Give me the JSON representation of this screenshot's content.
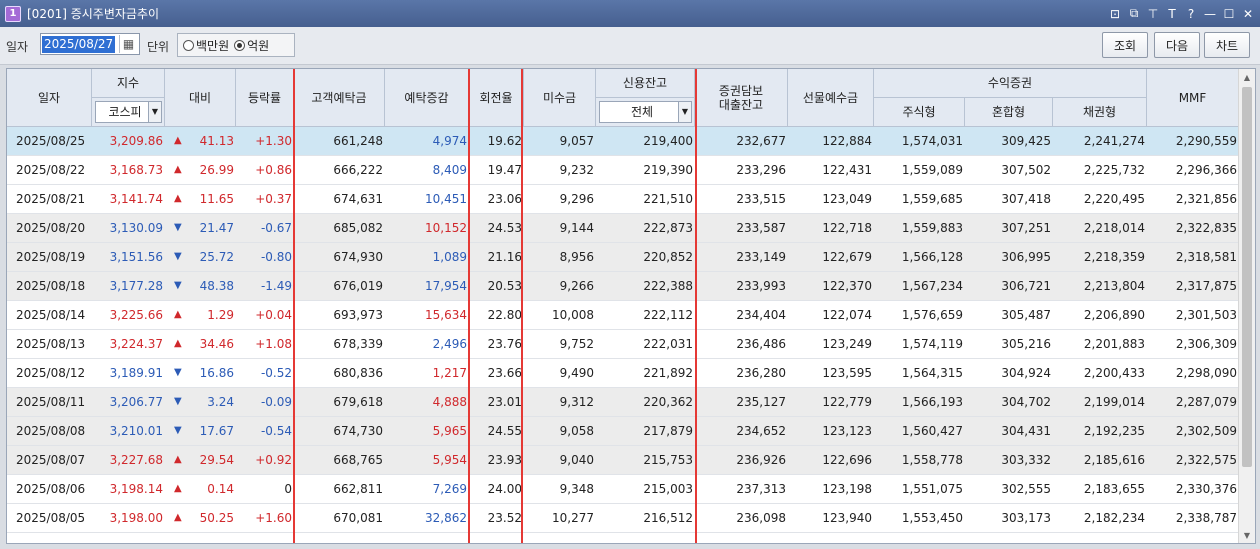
{
  "window": {
    "icon_label": "1",
    "title": "[0201] 증시주변자금추이",
    "controls": [
      "⊡",
      "⧉",
      "⊤",
      "T",
      "?",
      "—",
      "☐",
      "✕"
    ]
  },
  "toolbar": {
    "date_label": "일자",
    "date_value": "2025/08/27",
    "unit_label": "단위",
    "unit_options": [
      "백만원",
      "억원"
    ],
    "unit_selected": "억원",
    "btn_query": "조회",
    "btn_next": "다음",
    "btn_chart": "차트"
  },
  "headers": {
    "date": "일자",
    "index": "지수",
    "index_select": "코스피",
    "change": "대비",
    "rate": "등락률",
    "deposit": "고객예탁금",
    "deposit_change": "예탁증감",
    "turnover": "회전율",
    "unpaid": "미수금",
    "credit": "신용잔고",
    "credit_select": "전체",
    "collateral": "증권담보\n대출잔고",
    "futures": "선물예수금",
    "fund": "수익증권",
    "stock_fund": "주식형",
    "mixed_fund": "혼합형",
    "bond_fund": "채권형",
    "mmf": "MMF"
  },
  "colors": {
    "up": "#d0282c",
    "down": "#2c5bb6",
    "highlight_box": "#e53935",
    "selected_row": "#cfe6f3"
  },
  "rows": [
    {
      "date": "2025/08/25",
      "idx": "3,209.86",
      "dir": "up",
      "chg": "41.13",
      "rate": "+1.30",
      "dep": "661,248",
      "depchg": "4,974",
      "depdir": "dn",
      "turn": "19.62",
      "unpaid": "9,057",
      "credit": "219,400",
      "coll": "232,677",
      "fut": "122,884",
      "stock": "1,574,031",
      "mixed": "309,425",
      "bond": "2,241,274",
      "mmf": "2,290,559"
    },
    {
      "date": "2025/08/22",
      "idx": "3,168.73",
      "dir": "up",
      "chg": "26.99",
      "rate": "+0.86",
      "dep": "666,222",
      "depchg": "8,409",
      "depdir": "dn",
      "turn": "19.47",
      "unpaid": "9,232",
      "credit": "219,390",
      "coll": "233,296",
      "fut": "122,431",
      "stock": "1,559,089",
      "mixed": "307,502",
      "bond": "2,225,732",
      "mmf": "2,296,366"
    },
    {
      "date": "2025/08/21",
      "idx": "3,141.74",
      "dir": "up",
      "chg": "11.65",
      "rate": "+0.37",
      "dep": "674,631",
      "depchg": "10,451",
      "depdir": "dn",
      "turn": "23.06",
      "unpaid": "9,296",
      "credit": "221,510",
      "coll": "233,515",
      "fut": "123,049",
      "stock": "1,559,685",
      "mixed": "307,418",
      "bond": "2,220,495",
      "mmf": "2,321,856"
    },
    {
      "date": "2025/08/20",
      "idx": "3,130.09",
      "dir": "dn",
      "chg": "21.47",
      "rate": "-0.67",
      "dep": "685,082",
      "depchg": "10,152",
      "depdir": "up",
      "turn": "24.53",
      "unpaid": "9,144",
      "credit": "222,873",
      "coll": "233,587",
      "fut": "122,718",
      "stock": "1,559,883",
      "mixed": "307,251",
      "bond": "2,218,014",
      "mmf": "2,322,835"
    },
    {
      "date": "2025/08/19",
      "idx": "3,151.56",
      "dir": "dn",
      "chg": "25.72",
      "rate": "-0.80",
      "dep": "674,930",
      "depchg": "1,089",
      "depdir": "dn",
      "turn": "21.16",
      "unpaid": "8,956",
      "credit": "220,852",
      "coll": "233,149",
      "fut": "122,679",
      "stock": "1,566,128",
      "mixed": "306,995",
      "bond": "2,218,359",
      "mmf": "2,318,581"
    },
    {
      "date": "2025/08/18",
      "idx": "3,177.28",
      "dir": "dn",
      "chg": "48.38",
      "rate": "-1.49",
      "dep": "676,019",
      "depchg": "17,954",
      "depdir": "dn",
      "turn": "20.53",
      "unpaid": "9,266",
      "credit": "222,388",
      "coll": "233,993",
      "fut": "122,370",
      "stock": "1,567,234",
      "mixed": "306,721",
      "bond": "2,213,804",
      "mmf": "2,317,875"
    },
    {
      "date": "2025/08/14",
      "idx": "3,225.66",
      "dir": "up",
      "chg": "1.29",
      "rate": "+0.04",
      "dep": "693,973",
      "depchg": "15,634",
      "depdir": "up",
      "turn": "22.80",
      "unpaid": "10,008",
      "credit": "222,112",
      "coll": "234,404",
      "fut": "122,074",
      "stock": "1,576,659",
      "mixed": "305,487",
      "bond": "2,206,890",
      "mmf": "2,301,503"
    },
    {
      "date": "2025/08/13",
      "idx": "3,224.37",
      "dir": "up",
      "chg": "34.46",
      "rate": "+1.08",
      "dep": "678,339",
      "depchg": "2,496",
      "depdir": "dn",
      "turn": "23.76",
      "unpaid": "9,752",
      "credit": "222,031",
      "coll": "236,486",
      "fut": "123,249",
      "stock": "1,574,119",
      "mixed": "305,216",
      "bond": "2,201,883",
      "mmf": "2,306,309"
    },
    {
      "date": "2025/08/12",
      "idx": "3,189.91",
      "dir": "dn",
      "chg": "16.86",
      "rate": "-0.52",
      "dep": "680,836",
      "depchg": "1,217",
      "depdir": "up",
      "turn": "23.66",
      "unpaid": "9,490",
      "credit": "221,892",
      "coll": "236,280",
      "fut": "123,595",
      "stock": "1,564,315",
      "mixed": "304,924",
      "bond": "2,200,433",
      "mmf": "2,298,090"
    },
    {
      "date": "2025/08/11",
      "idx": "3,206.77",
      "dir": "dn",
      "chg": "3.24",
      "rate": "-0.09",
      "dep": "679,618",
      "depchg": "4,888",
      "depdir": "up",
      "turn": "23.01",
      "unpaid": "9,312",
      "credit": "220,362",
      "coll": "235,127",
      "fut": "122,779",
      "stock": "1,566,193",
      "mixed": "304,702",
      "bond": "2,199,014",
      "mmf": "2,287,079"
    },
    {
      "date": "2025/08/08",
      "idx": "3,210.01",
      "dir": "dn",
      "chg": "17.67",
      "rate": "-0.54",
      "dep": "674,730",
      "depchg": "5,965",
      "depdir": "up",
      "turn": "24.55",
      "unpaid": "9,058",
      "credit": "217,879",
      "coll": "234,652",
      "fut": "123,123",
      "stock": "1,560,427",
      "mixed": "304,431",
      "bond": "2,192,235",
      "mmf": "2,302,509"
    },
    {
      "date": "2025/08/07",
      "idx": "3,227.68",
      "dir": "up",
      "chg": "29.54",
      "rate": "+0.92",
      "dep": "668,765",
      "depchg": "5,954",
      "depdir": "up",
      "turn": "23.93",
      "unpaid": "9,040",
      "credit": "215,753",
      "coll": "236,926",
      "fut": "122,696",
      "stock": "1,558,778",
      "mixed": "303,332",
      "bond": "2,185,616",
      "mmf": "2,322,575"
    },
    {
      "date": "2025/08/06",
      "idx": "3,198.14",
      "dir": "up",
      "chg": "0.14",
      "rate": "0",
      "dep": "662,811",
      "depchg": "7,269",
      "depdir": "dn",
      "turn": "24.00",
      "unpaid": "9,348",
      "credit": "215,003",
      "coll": "237,313",
      "fut": "123,198",
      "stock": "1,551,075",
      "mixed": "302,555",
      "bond": "2,183,655",
      "mmf": "2,330,376"
    },
    {
      "date": "2025/08/05",
      "idx": "3,198.00",
      "dir": "up",
      "chg": "50.25",
      "rate": "+1.60",
      "dep": "670,081",
      "depchg": "32,862",
      "depdir": "dn",
      "turn": "23.52",
      "unpaid": "10,277",
      "credit": "216,512",
      "coll": "236,098",
      "fut": "123,940",
      "stock": "1,553,450",
      "mixed": "303,173",
      "bond": "2,182,234",
      "mmf": "2,338,787"
    }
  ]
}
